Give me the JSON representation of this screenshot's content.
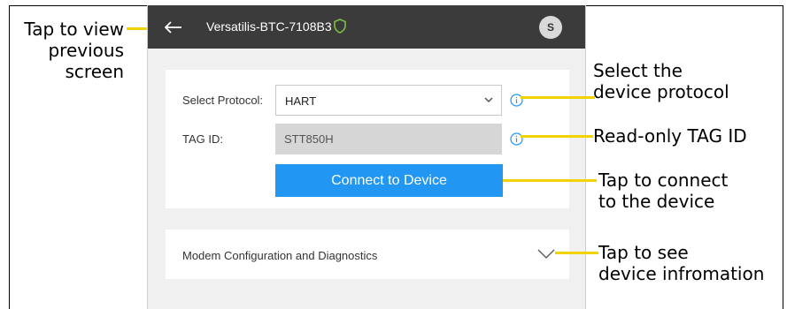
{
  "appbar": {
    "title": "Versatilis-BTC-7108B3",
    "avatar_initial": "S",
    "back_icon": "back-arrow-icon",
    "secure_icon": "shield-icon"
  },
  "protocol": {
    "label": "Select Protocol:",
    "value": "HART"
  },
  "tag": {
    "label": "TAG ID:",
    "value": "STT850H"
  },
  "connect_button": "Connect to Device",
  "accordion": {
    "label": "Modem Configuration and Diagnostics"
  },
  "callouts": {
    "back": [
      "Tap to view",
      "previous",
      "screen"
    ],
    "protocol": [
      "Select the",
      "device protocol"
    ],
    "tag": "Read-only TAG ID",
    "connect": [
      "Tap to connect",
      "to the device"
    ],
    "info": [
      "Tap to see",
      "device infromation"
    ]
  },
  "colors": {
    "appbar": "#3b3b3b",
    "button": "#2196f3",
    "callout_line": "#f2d200",
    "shield": "#7bc043",
    "info_icon": "#2196f3"
  }
}
